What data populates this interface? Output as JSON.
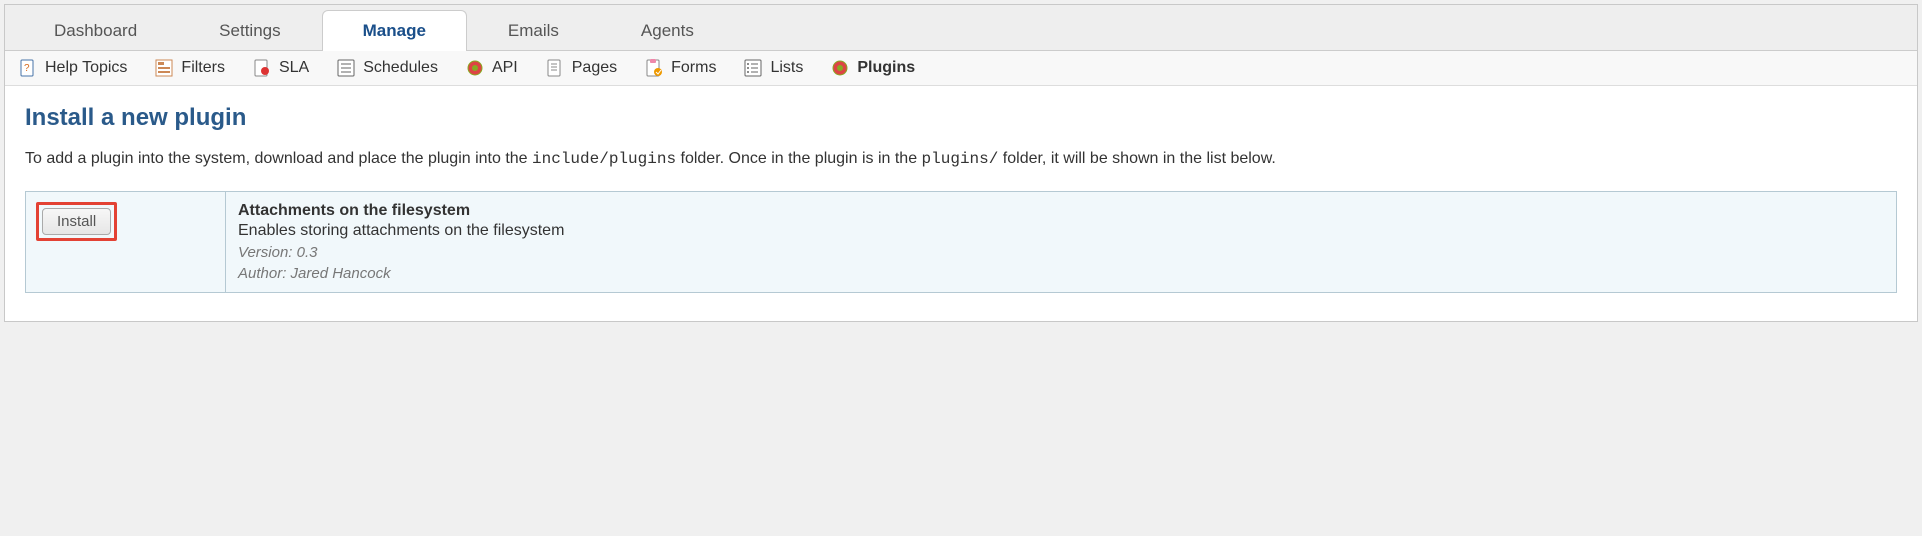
{
  "main_tabs": {
    "dashboard": "Dashboard",
    "settings": "Settings",
    "manage": "Manage",
    "emails": "Emails",
    "agents": "Agents"
  },
  "sub_nav": {
    "help_topics": "Help Topics",
    "filters": "Filters",
    "sla": "SLA",
    "schedules": "Schedules",
    "api": "API",
    "pages": "Pages",
    "forms": "Forms",
    "lists": "Lists",
    "plugins": "Plugins"
  },
  "page": {
    "title": "Install a new plugin",
    "desc_pre": "To add a plugin into the system, download and place the plugin into the ",
    "code1": "include/plugins",
    "desc_mid": " folder. Once in the plugin is in the ",
    "code2": "plugins/",
    "desc_post": " folder, it will be shown in the list below."
  },
  "plugin": {
    "install_label": "Install",
    "name": "Attachments on the filesystem",
    "description": "Enables storing attachments on the filesystem",
    "version": "Version: 0.3",
    "author": "Author: Jared Hancock"
  }
}
